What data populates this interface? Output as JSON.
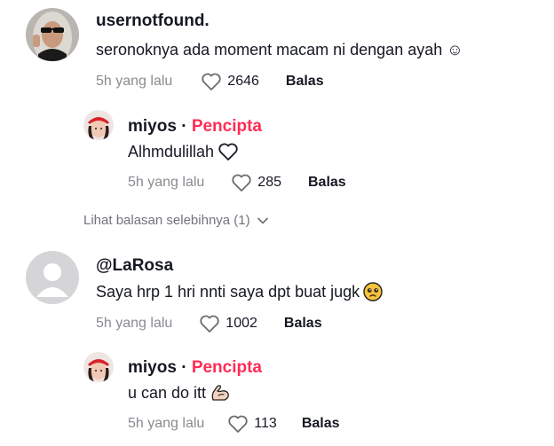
{
  "comments": [
    {
      "username": "usernotfound.",
      "text": "seronoknya ada moment macam ni dengan ayah ☺",
      "time": "5h yang lalu",
      "likes": "2646",
      "reply_label": "Balas",
      "avatar_icon": "user-photo-sunglasses-hijab-icon",
      "replies": [
        {
          "username": "miyos",
          "dot": "·",
          "badge": "Pencipta",
          "text": "Alhmdulillah",
          "emoji_icon": "heart-outline-icon",
          "time": "5h yang lalu",
          "likes": "285",
          "reply_label": "Balas",
          "avatar_icon": "user-photo-red-beret-icon"
        }
      ],
      "more_replies": "Lihat balasan selebihnya (1)"
    },
    {
      "username": "@LaRosa",
      "text": "Saya hrp 1 hri nnti saya dpt buat jugk",
      "emoji_icon": "pleading-face-emoji-icon",
      "time": "5h yang lalu",
      "likes": "1002",
      "reply_label": "Balas",
      "avatar_icon": "default-avatar-icon",
      "replies": [
        {
          "username": "miyos",
          "dot": "·",
          "badge": "Pencipta",
          "text": "u can do itt",
          "emoji_icon": "flexed-biceps-emoji-icon",
          "time": "5h yang lalu",
          "likes": "113",
          "reply_label": "Balas",
          "avatar_icon": "user-photo-red-beret-icon"
        }
      ]
    }
  ],
  "colors": {
    "creator_badge": "#fe2c55",
    "time_text": "#8a8b91",
    "default_avatar_bg": "#d5d5d8"
  }
}
